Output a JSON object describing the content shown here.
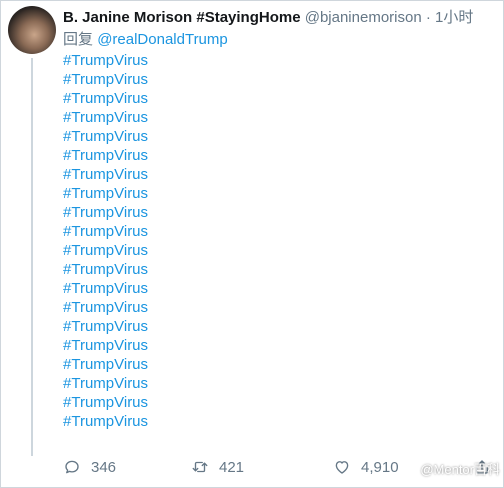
{
  "tweet": {
    "display_name": "B. Janine Morison #StayingHome",
    "handle": "@bjaninemorison",
    "separator": "·",
    "time": "1小时",
    "reply_prefix": "回复",
    "reply_to": "@realDonaldTrump",
    "hashtags": [
      "#TrumpVirus",
      "#TrumpVirus",
      "#TrumpVirus",
      "#TrumpVirus",
      "#TrumpVirus",
      "#TrumpVirus",
      "#TrumpVirus",
      "#TrumpVirus",
      "#TrumpVirus",
      "#TrumpVirus",
      "#TrumpVirus",
      "#TrumpVirus",
      "#TrumpVirus",
      "#TrumpVirus",
      "#TrumpVirus",
      "#TrumpVirus",
      "#TrumpVirus",
      "#TrumpVirus",
      "#TrumpVirus",
      "#TrumpVirus"
    ]
  },
  "actions": {
    "replies": "346",
    "retweets": "421",
    "likes": "4,910"
  },
  "icons": {
    "reply": "reply-bubble-icon",
    "retweet": "retweet-arrows-icon",
    "like": "heart-icon",
    "share": "share-icon"
  },
  "watermark": "@Mentor百科",
  "colors": {
    "link": "#1b95e0",
    "muted": "#657786",
    "text": "#14171a"
  }
}
